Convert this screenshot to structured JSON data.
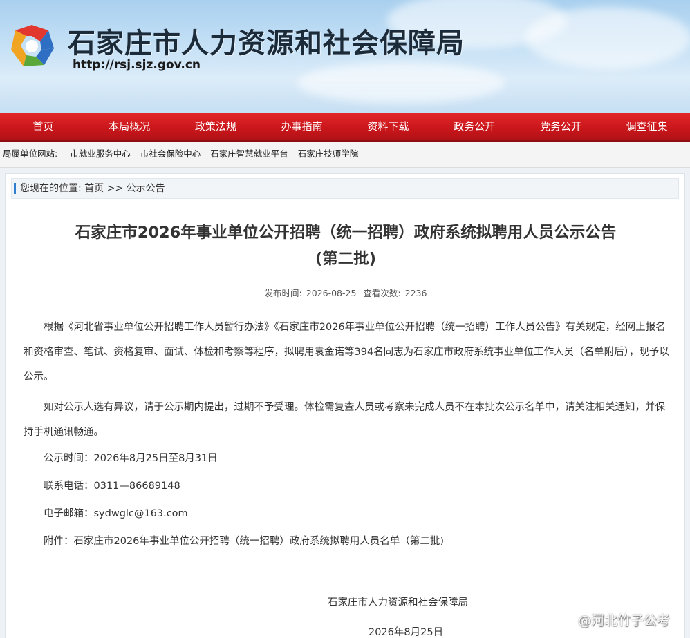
{
  "header": {
    "site_title": "石家庄市人力资源和社会保障局",
    "url": "http://rsj.sjz.gov.cn"
  },
  "nav": {
    "items": [
      "首页",
      "本局概况",
      "政策法规",
      "办事指南",
      "资料下载",
      "政务公开",
      "党务公开",
      "调查征集"
    ]
  },
  "affiliates": {
    "label": "局属单位网站:",
    "links": [
      "市就业服务中心",
      "市社会保险中心",
      "石家庄智慧就业平台",
      "石家庄技师学院"
    ]
  },
  "breadcrumb": {
    "prefix": "您现在的位置:",
    "home": "首页",
    "separator": ">>",
    "current": "公示公告"
  },
  "article": {
    "title_line1": "石家庄市2026年事业单位公开招聘（统一招聘）政府系统拟聘用人员公示公告",
    "title_line2": "(第二批)",
    "publish_label": "发布时间:",
    "publish_date": "2026-08-25",
    "views_label": "查看次数:",
    "views": "2236",
    "para1": "根据《河北省事业单位公开招聘工作人员暂行办法》《石家庄市2026年事业单位公开招聘（统一招聘）工作人员公告》有关规定，经网上报名和资格审查、笔试、资格复审、面试、体检和考察等程序，拟聘用袁金诺等394名同志为石家庄市政府系统事业单位工作人员（名单附后），现予以公示。",
    "para2": "如对公示人选有异议，请于公示期内提出，过期不予受理。体检需复查人员或考察未完成人员不在本批次公示名单中，请关注相关通知，并保持手机通讯畅通。",
    "period": "公示时间：2026年8月25日至8月31日",
    "phone": "联系电话：0311—86689148",
    "email": "电子邮箱：sydwglc@163.com",
    "attachment_label": "附件：",
    "attachment_name": "石家庄市2026年事业单位公开招聘（统一招聘）政府系统拟聘用人员名单（第二批)",
    "sign_org": "石家庄市人力资源和社会保障局",
    "sign_date": "2026年8月25日"
  },
  "watermark": {
    "text": "@河北竹子公考",
    "icon": "weibo-icon"
  },
  "colors": {
    "nav_red": "#c8161b",
    "breadcrumb_accent": "#2f7fd1"
  }
}
